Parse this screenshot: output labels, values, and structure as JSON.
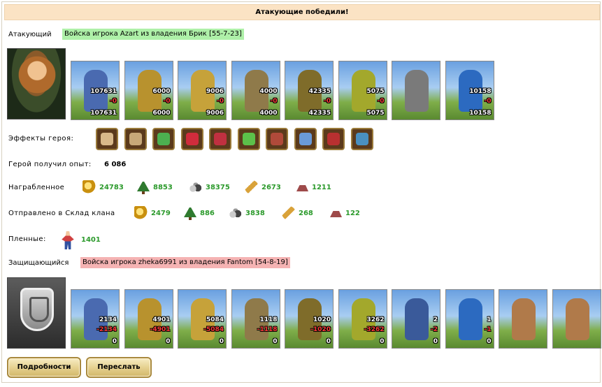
{
  "banner": {
    "text": "Атакующие победили!"
  },
  "attacker": {
    "label": "Атакующий",
    "army_tag": "Войска игрока Azart из владения Брик [55-7-23]",
    "units": [
      {
        "icon": "cavalry-unit-icon",
        "top": "107631",
        "mid": "-0",
        "bottom": "107631",
        "color": "#4a6ab0"
      },
      {
        "icon": "archer-unit-icon",
        "top": "6000",
        "mid": "-0",
        "bottom": "6000",
        "color": "#b8922e"
      },
      {
        "icon": "horseman-unit-icon",
        "top": "9006",
        "mid": "-0",
        "bottom": "9006",
        "color": "#c6a23a"
      },
      {
        "icon": "pegasus-rider-unit-icon",
        "top": "4000",
        "mid": "-0",
        "bottom": "4000",
        "color": "#8f7a4a"
      },
      {
        "icon": "crossbowman-unit-icon",
        "top": "42335",
        "mid": "-0",
        "bottom": "42335",
        "color": "#7f6c2a"
      },
      {
        "icon": "druid-unit-icon",
        "top": "5075",
        "mid": "-0",
        "bottom": "5075",
        "color": "#a3a82c"
      },
      {
        "icon": "grey-warrior-unit-icon",
        "top": "",
        "mid": "",
        "bottom": "",
        "color": "#7a7a7a"
      },
      {
        "icon": "mage-unit-icon",
        "top": "10158",
        "mid": "-0",
        "bottom": "10158",
        "color": "#2c6ac0"
      }
    ]
  },
  "hero_effects": {
    "label": "Эффекты героя:",
    "items": [
      {
        "icon": "double-face-icon",
        "color": "#d8b98a"
      },
      {
        "icon": "face-orb-icon",
        "color": "#c7a878"
      },
      {
        "icon": "green-wand-icon",
        "color": "#4caf50"
      },
      {
        "icon": "heart-icon",
        "color": "#d02c3c"
      },
      {
        "icon": "heart-sword-icon",
        "color": "#c03040"
      },
      {
        "icon": "green-potion-icon",
        "color": "#5cc04a"
      },
      {
        "icon": "red-armor-icon",
        "color": "#b04a3a"
      },
      {
        "icon": "globe-icon",
        "color": "#6a9ad8"
      },
      {
        "icon": "red-figure-icon",
        "color": "#b83030"
      },
      {
        "icon": "world-shield-icon",
        "color": "#4a90c0"
      }
    ]
  },
  "experience": {
    "label": "Герой получил опыт:",
    "value": "6 086"
  },
  "loot": {
    "label": "Награбленное",
    "items": [
      {
        "icon": "gold-icon",
        "value": "24783"
      },
      {
        "icon": "wood-icon",
        "value": "8853"
      },
      {
        "icon": "ore-icon",
        "value": "38375"
      },
      {
        "icon": "wheat-icon",
        "value": "2673"
      },
      {
        "icon": "stone-icon",
        "value": "1211"
      }
    ]
  },
  "clan_storage": {
    "label": "Отправлено в Склад клана",
    "items": [
      {
        "icon": "gold-icon",
        "value": "2479"
      },
      {
        "icon": "wood-icon",
        "value": "886"
      },
      {
        "icon": "ore-icon",
        "value": "3838"
      },
      {
        "icon": "wheat-icon",
        "value": "268"
      },
      {
        "icon": "stone-icon",
        "value": "122"
      }
    ]
  },
  "prisoners": {
    "label": "Пленные:",
    "icon": "prisoner-icon",
    "value": "1401"
  },
  "defender": {
    "label": "Защищающийся",
    "army_tag": "Войска игрока zheka6991 из владения Fantom [54-8-19]",
    "units": [
      {
        "icon": "cavalry-unit-icon",
        "top": "2134",
        "mid": "-2134",
        "bottom": "0",
        "color": "#4a6ab0"
      },
      {
        "icon": "archer-unit-icon",
        "top": "4901",
        "mid": "-4901",
        "bottom": "0",
        "color": "#b8922e"
      },
      {
        "icon": "horseman-unit-icon",
        "top": "5084",
        "mid": "-5084",
        "bottom": "0",
        "color": "#c6a23a"
      },
      {
        "icon": "pegasus-rider-unit-icon",
        "top": "1118",
        "mid": "-1118",
        "bottom": "0",
        "color": "#8f7a4a"
      },
      {
        "icon": "crossbowman-unit-icon",
        "top": "1020",
        "mid": "-1020",
        "bottom": "0",
        "color": "#7f6c2a"
      },
      {
        "icon": "druid-unit-icon",
        "top": "3262",
        "mid": "-3262",
        "bottom": "0",
        "color": "#a3a82c"
      },
      {
        "icon": "swordsman-unit-icon",
        "top": "2",
        "mid": "-2",
        "bottom": "0",
        "color": "#3a5a9a"
      },
      {
        "icon": "mage-unit-icon",
        "top": "1",
        "mid": "-1",
        "bottom": "0",
        "color": "#2c6ac0"
      },
      {
        "icon": "tower-icon",
        "top": "",
        "mid": "",
        "bottom": "",
        "color": "#b07a4a"
      },
      {
        "icon": "tower-icon",
        "top": "",
        "mid": "",
        "bottom": "",
        "color": "#b07a4a"
      }
    ]
  },
  "buttons": {
    "details": "Подробности",
    "forward": "Переслать"
  }
}
